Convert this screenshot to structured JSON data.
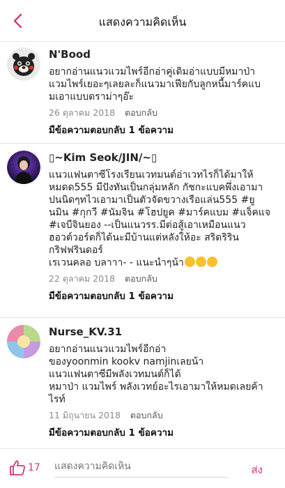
{
  "header": {
    "title": "แสดงความคิดเห็น",
    "back_icon": "chevron-left-icon",
    "accent": "#d63384"
  },
  "comments": [
    {
      "name": "N'Bood",
      "lines": [
        "อยากอ่านแนวแวมไพร์อีกอ่าคู่เดิมอ่าแบบมีหมาป่า",
        "แวมไพร์เยอะๆเลยละก็แนวมาเฟียกับลูกหนี้มาร์คแบ",
        "มเอาแบบดราม่าๆอ๊ะ"
      ],
      "date": "26 ตุลาคม 2018",
      "reply": "ตอบกลับ",
      "replies": "มีข้อความตอบกลับ 1 ข้อความ"
    },
    {
      "name": "▯~Kim Seok/JIN/~▯",
      "lines": [
        "แนวแฟนตาซีโรงเรียนเวทมนต์อ่าเวทไรก็ได้มาให้",
        "หมดด555 มีปังทันเป็นกลุ่มหลัก กัชกะแบคพึ่งเอามา",
        "ปนนิดๆทไวเอามาเป็นตัวจัดขวางเรือแล่น555 #ยู",
        "นมิน #กุกวี #นัมจิน #โฮปยูค #มาร์คแบม #แจ็คแจ",
        "#เจบีจินยอง --เป็นแนวรร.มีต่อสู้เอาเหมือนแนว",
        "ฮอวต์วอร์ตก็ได้นะมีบ้านแต่หลังให้อะ สริดริริน",
        "กริฟฟรินดอร์",
        "เรเวนคลอ บลาาา- - แนะนำๆน้า"
      ],
      "date": "22 ตุลาคม 2018",
      "reply": "ตอบกลับ",
      "replies": "มีข้อความตอบกลับ 1 ข้อความ"
    },
    {
      "name": "Nurse_KV.31",
      "lines": [
        "อยากอ่านแนวแวมไพร์อีกอ่า",
        "ของyoonmin kookv namjinเลยน้า",
        "แนวแฟนตาซีมีพลังเวทมนต์ก็ได้",
        "หมาป่า แวมไพร์ พลังเวทย์อะไรเอามาให้หมดเลยค้า",
        "ไรท์"
      ],
      "date": "11 มิถุนายน 2018",
      "reply": "ตอบกลับ",
      "replies": "มีข้อความตอบกลับ 1 ข้อความ"
    }
  ],
  "footer": {
    "like_count": "17",
    "input_placeholder": "แสดงความคิดเห็น",
    "send_label": "ส่ง"
  }
}
